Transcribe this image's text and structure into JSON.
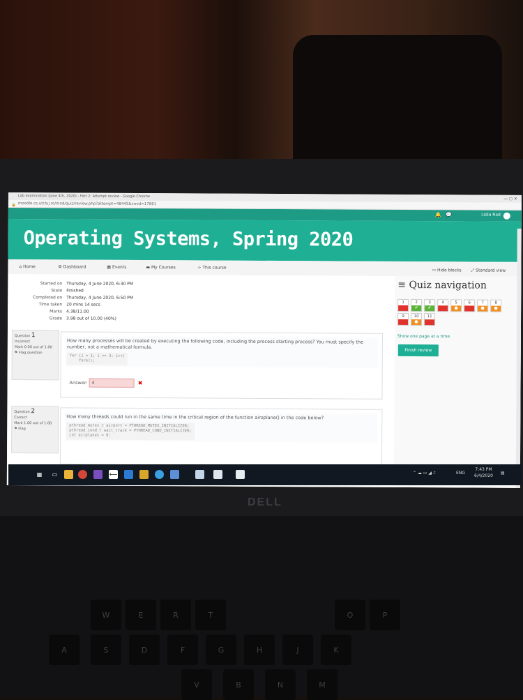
{
  "browser": {
    "tab_title": "Lab examination (June 4th, 2020) - Part 2: Attempt review - Google Chrome",
    "url": "moodle.cs.utcluj.ro/mod/quiz/review.php?attempt=48445&cmid=17861",
    "window_controls": "—   ◻   ✕"
  },
  "topbar": {
    "user_name": "Lidia Rad"
  },
  "course_title": "Operating Systems, Spring 2020",
  "nav": {
    "home": "Home",
    "dashboard": "Dashboard",
    "events": "Events",
    "my_courses": "My Courses",
    "this_course": "This course",
    "hide_blocks": "Hide blocks",
    "standard_view": "Standard view"
  },
  "summary": [
    {
      "label": "Started on",
      "value": "Thursday, 4 June 2020, 6:30 PM"
    },
    {
      "label": "State",
      "value": "Finished"
    },
    {
      "label": "Completed on",
      "value": "Thursday, 4 June 2020, 6:50 PM"
    },
    {
      "label": "Time taken",
      "value": "20 mins 14 secs"
    },
    {
      "label": "Marks",
      "value": "4.38/11.00"
    },
    {
      "label": "Grade",
      "value": "3.98 out of 10.00 (40%)"
    }
  ],
  "questions": [
    {
      "label": "Question",
      "number": "1",
      "status": "Incorrect",
      "mark": "Mark 0.00 out of 1.00",
      "flag": "Flag question",
      "text": "How many processes will be created by executing the following code, including the process starting process? You must specify the number, not a mathematical formula.",
      "code": "for (i = 1; i <= 3; i++)\n    fork();",
      "answer_label": "Answer:",
      "answer_value": "4"
    },
    {
      "label": "Question",
      "number": "2",
      "status": "Correct",
      "mark": "Mark 1.00 out of 1.00",
      "flag": "Flag",
      "text": "How many threads could run in the same time in the critical region of the function airoplane() in the code below?",
      "code": "pthread_mutex_t airport = PTHREAD_MUTEX_INITIALIZER;\npthread_cond_t wait_track = PTHREAD_COND_INITIALIZER;\nint airplanes = 0;"
    }
  ],
  "quiz_nav": {
    "title": "Quiz navigation",
    "buttons": [
      {
        "n": "1",
        "state": "red"
      },
      {
        "n": "2",
        "state": "green"
      },
      {
        "n": "3",
        "state": "green"
      },
      {
        "n": "4",
        "state": "red"
      },
      {
        "n": "5",
        "state": "orange"
      },
      {
        "n": "6",
        "state": "red"
      },
      {
        "n": "7",
        "state": "orange"
      },
      {
        "n": "8",
        "state": "orange"
      },
      {
        "n": "9",
        "state": "red"
      },
      {
        "n": "10",
        "state": "orange"
      },
      {
        "n": "11",
        "state": "red"
      }
    ],
    "show_one_page": "Show one page at a time",
    "finish_review": "Finish review"
  },
  "taskbar": {
    "time": "7:43 PM",
    "date": "6/4/2020",
    "lang": "ENG"
  },
  "laptop_brand": "DELL",
  "colors": {
    "brand": "#1eaf94",
    "incorrect": "#e0332d",
    "correct": "#5bb33a",
    "partial": "#f28f20"
  }
}
